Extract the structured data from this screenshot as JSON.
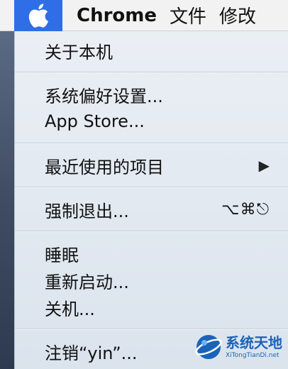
{
  "menubar": {
    "apple_icon": "apple-logo-icon",
    "app_name": "Chrome",
    "items": [
      "文件",
      "修改"
    ]
  },
  "menu": {
    "groups": [
      [
        {
          "label": "关于本机"
        }
      ],
      [
        {
          "label": "系统偏好设置..."
        },
        {
          "label": "App Store..."
        }
      ],
      [
        {
          "label": "最近使用的项目",
          "submenu_icon": "▶"
        }
      ],
      [
        {
          "label": "强制退出...",
          "shortcut": "⌥⌘⎋"
        }
      ],
      [
        {
          "label": "睡眠"
        },
        {
          "label": "重新启动..."
        },
        {
          "label": "关机..."
        }
      ],
      [
        {
          "label": "注销“yin”..."
        }
      ]
    ]
  },
  "watermark": {
    "title": "系统天地",
    "subtitle": "XiTongTianDi.net"
  },
  "colors": {
    "menubar_highlight": "#2f6ee6",
    "watermark": "#1a63b8"
  }
}
